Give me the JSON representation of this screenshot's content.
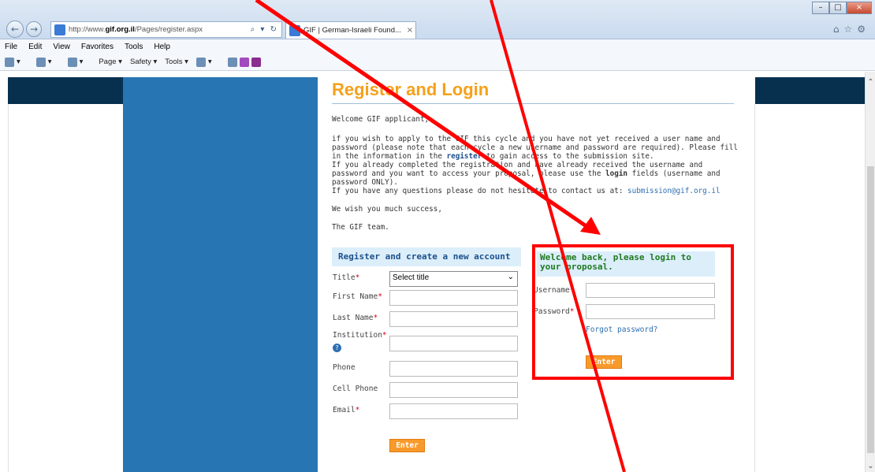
{
  "browser": {
    "url_prefix": "http://www.",
    "url_domain": "gif.org.il",
    "url_path": "/Pages/register.aspx",
    "address_controls": "⌕ ▾ ↻",
    "tab_title": "GIF | German-Israeli Found...",
    "tab_close": "×",
    "menu": [
      "File",
      "Edit",
      "View",
      "Favorites",
      "Tools",
      "Help"
    ],
    "commands": [
      "▾",
      "▾",
      "▾",
      "Page ▾",
      "Safety ▾",
      "Tools ▾",
      "▾"
    ],
    "win_min": "–",
    "win_max": "□",
    "win_close": "×",
    "right_icons": "⌂☆⚙"
  },
  "page": {
    "title": "Register and Login",
    "greeting": "Welcome GIF applicant,",
    "intro_1": "if you wish to apply to the GIF this cycle and you have not yet received a user name and password (please note that each cycle a new username and password are required). Please fill in the information in the ",
    "intro_register_word": "register",
    "intro_2": " to gain access to the submission site.",
    "intro_3": "If you already completed the registration and have already received the username and password and you want to access your proposal, please use the ",
    "intro_login_word": "login",
    "intro_4": " fields (username and password ONLY).",
    "intro_5": "If you have any questions please do not hesitate to contact us at: ",
    "contact_email": "submission@gif.org.il",
    "wish": "We wish you much success,",
    "signoff": "The GIF team."
  },
  "register": {
    "heading": "Register and create a new account",
    "title_label": "Title",
    "title_value": "Select title",
    "first_name_label": "First Name",
    "last_name_label": "Last Name",
    "institution_label": "Institution",
    "phone_label": "Phone",
    "cell_label": "Cell Phone",
    "email_label": "Email",
    "required_mark": "*",
    "help_glyph": "?",
    "enter_label": "Enter"
  },
  "login": {
    "heading": "Welcome back, please login to your proposal.",
    "username_label": "Username",
    "password_label": "Password",
    "required_mark": "*",
    "forgot": "Forgot password?",
    "enter_label": "Enter"
  },
  "annotation": {
    "color": "#ff0000"
  }
}
